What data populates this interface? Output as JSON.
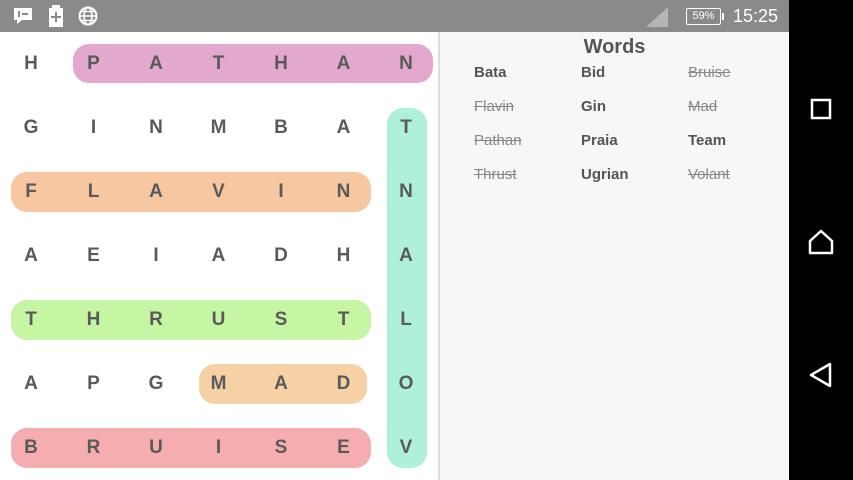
{
  "status_bar": {
    "time": "15:25",
    "battery": "59%",
    "icons": [
      "message-icon",
      "battery-saver-icon",
      "globe-icon",
      "signal-icon"
    ]
  },
  "grid": {
    "rows": [
      [
        "H",
        "P",
        "A",
        "T",
        "H",
        "A",
        "N"
      ],
      [
        "G",
        "I",
        "N",
        "M",
        "B",
        "A",
        "T"
      ],
      [
        "F",
        "L",
        "A",
        "V",
        "I",
        "N",
        "N"
      ],
      [
        "A",
        "E",
        "I",
        "A",
        "D",
        "H",
        "A"
      ],
      [
        "T",
        "H",
        "R",
        "U",
        "S",
        "T",
        "L"
      ],
      [
        "A",
        "P",
        "G",
        "M",
        "A",
        "D",
        "O"
      ],
      [
        "B",
        "R",
        "U",
        "I",
        "S",
        "E",
        "V"
      ]
    ],
    "highlights": [
      {
        "word": "PATHAN",
        "color": "#e3a8cd"
      },
      {
        "word": "FLAVIN",
        "color": "#f6c7a0"
      },
      {
        "word": "THRUST",
        "color": "#c6f6a4"
      },
      {
        "word": "MAD",
        "color": "#f6d1a6"
      },
      {
        "word": "BRUISE",
        "color": "#f6adb0"
      },
      {
        "word": "VOLANT",
        "color": "#aef0da"
      }
    ]
  },
  "words_panel": {
    "title": "Words",
    "words": [
      {
        "text": "Bata",
        "found": false
      },
      {
        "text": "Bid",
        "found": false
      },
      {
        "text": "Bruise",
        "found": true
      },
      {
        "text": "Flavin",
        "found": true
      },
      {
        "text": "Gin",
        "found": false
      },
      {
        "text": "Mad",
        "found": true
      },
      {
        "text": "Pathan",
        "found": true
      },
      {
        "text": "Praia",
        "found": false
      },
      {
        "text": "Team",
        "found": false
      },
      {
        "text": "Thrust",
        "found": true
      },
      {
        "text": "Ugrian",
        "found": false
      },
      {
        "text": "Volant",
        "found": true
      }
    ]
  },
  "nav_bar": {
    "buttons": [
      "recents-button",
      "home-button",
      "back-button"
    ]
  }
}
